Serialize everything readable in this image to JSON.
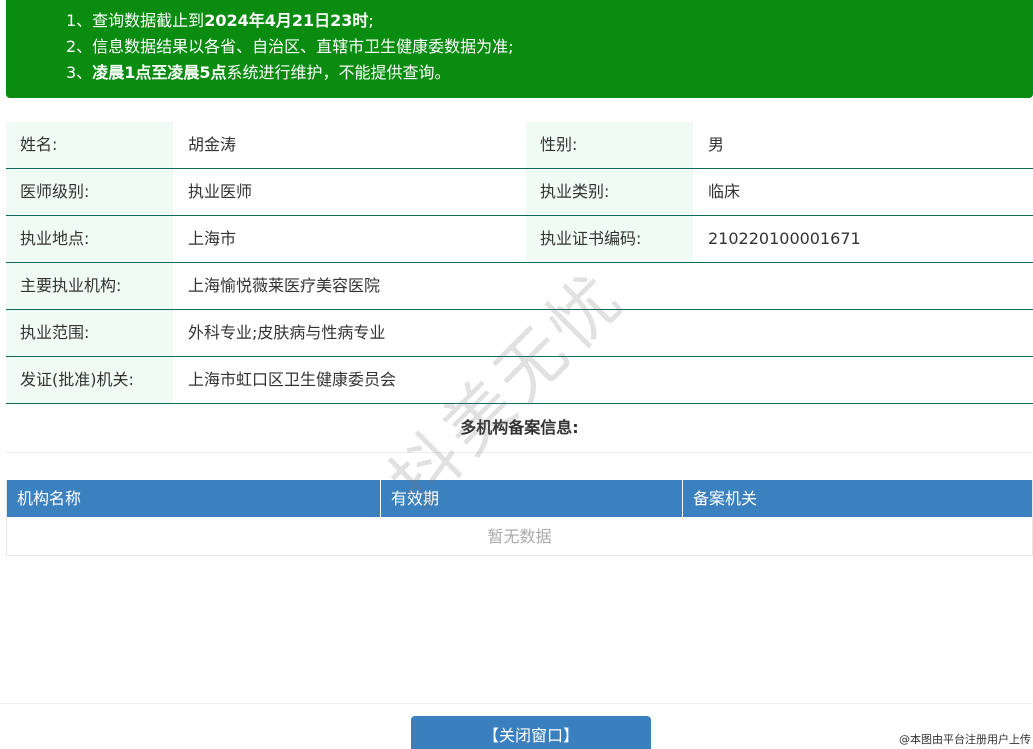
{
  "notice": {
    "line1_prefix": "1、查询数据截止到",
    "line1_bold": "2024年4月21日23时",
    "line1_suffix": ";",
    "line2": "2、信息数据结果以各省、自治区、直辖市卫生健康委数据为准;",
    "line3_prefix": "3、",
    "line3_bold": "凌晨1点至凌晨5点",
    "line3_suffix": "系统进行维护，不能提供查询。"
  },
  "info": {
    "name_label": "姓名:",
    "name_value": "胡金涛",
    "gender_label": "性别:",
    "gender_value": "男",
    "level_label": "医师级别:",
    "level_value": "执业医师",
    "category_label": "执业类别:",
    "category_value": "临床",
    "location_label": "执业地点:",
    "location_value": "上海市",
    "cert_label": "执业证书编码:",
    "cert_value": "210220100001671",
    "institution_label": "主要执业机构:",
    "institution_value": "上海愉悦薇莱医疗美容医院",
    "scope_label": "执业范围:",
    "scope_value": "外科专业;皮肤病与性病专业",
    "issuer_label": "发证(批准)机关:",
    "issuer_value": "上海市虹口区卫生健康委员会"
  },
  "multi": {
    "title": "多机构备案信息:",
    "columns": [
      "机构名称",
      "有效期",
      "备案机关"
    ],
    "empty_text": "暂无数据"
  },
  "footer": {
    "close_label": "【关闭窗口】"
  },
  "overlay": {
    "watermark": "抖美无忧",
    "credit": "@本图由平台注册用户上传"
  }
}
